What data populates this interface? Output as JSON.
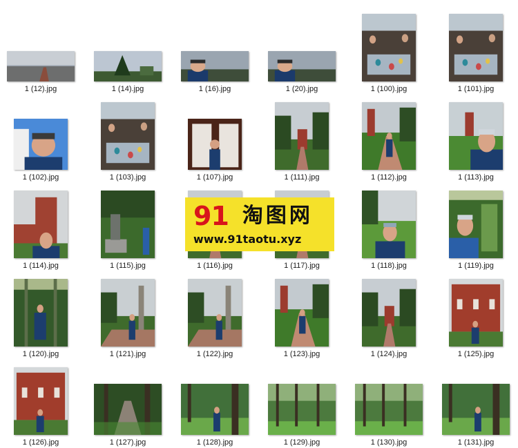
{
  "files": [
    {
      "name": "1 (12).jpg",
      "kind": "landscape",
      "scene": "sky-road"
    },
    {
      "name": "1 (14).jpg",
      "kind": "landscape",
      "scene": "sky-tree"
    },
    {
      "name": "1 (16).jpg",
      "kind": "landscape",
      "scene": "selfie-wide"
    },
    {
      "name": "1 (20).jpg",
      "kind": "landscape",
      "scene": "selfie-wide"
    },
    {
      "name": "1 (100).jpg",
      "kind": "portrait",
      "scene": "crowd"
    },
    {
      "name": "1 (101).jpg",
      "kind": "portrait",
      "scene": "crowd"
    },
    {
      "name": "1 (102).jpg",
      "kind": "portrait-short",
      "scene": "selfie-blue"
    },
    {
      "name": "1 (103).jpg",
      "kind": "portrait",
      "scene": "crowd"
    },
    {
      "name": "1 (107).jpg",
      "kind": "portrait-short",
      "scene": "angels"
    },
    {
      "name": "1 (111).jpg",
      "kind": "portrait",
      "scene": "park-tower"
    },
    {
      "name": "1 (112).jpg",
      "kind": "portrait",
      "scene": "park-person"
    },
    {
      "name": "1 (113).jpg",
      "kind": "portrait",
      "scene": "park-selfie"
    },
    {
      "name": "1 (114).jpg",
      "kind": "portrait",
      "scene": "tower-selfie"
    },
    {
      "name": "1 (115).jpg",
      "kind": "portrait",
      "scene": "statue"
    },
    {
      "name": "1 (116).jpg",
      "kind": "portrait",
      "scene": "park-tower"
    },
    {
      "name": "1 (117).jpg",
      "kind": "portrait",
      "scene": "park-tower"
    },
    {
      "name": "1 (118).jpg",
      "kind": "portrait",
      "scene": "lawn-selfie"
    },
    {
      "name": "1 (119).jpg",
      "kind": "portrait",
      "scene": "arch-selfie"
    },
    {
      "name": "1 (120).jpg",
      "kind": "portrait",
      "scene": "arch-person"
    },
    {
      "name": "1 (121).jpg",
      "kind": "portrait",
      "scene": "column-person"
    },
    {
      "name": "1 (122).jpg",
      "kind": "portrait",
      "scene": "column-person"
    },
    {
      "name": "1 (123).jpg",
      "kind": "portrait",
      "scene": "park-person"
    },
    {
      "name": "1 (124).jpg",
      "kind": "portrait",
      "scene": "park-tower"
    },
    {
      "name": "1 (125).jpg",
      "kind": "portrait",
      "scene": "redbuilding-person"
    },
    {
      "name": "1 (126).jpg",
      "kind": "portrait",
      "scene": "redbuilding-person"
    },
    {
      "name": "1 (127).jpg",
      "kind": "landscape-tall",
      "scene": "forest-path"
    },
    {
      "name": "1 (128).jpg",
      "kind": "landscape-tall",
      "scene": "forest-person"
    },
    {
      "name": "1 (129).jpg",
      "kind": "landscape-tall",
      "scene": "forest"
    },
    {
      "name": "1 (130).jpg",
      "kind": "landscape-tall",
      "scene": "forest"
    },
    {
      "name": "1 (131).jpg",
      "kind": "landscape-tall",
      "scene": "forest-person"
    }
  ],
  "watermark": {
    "number": "91",
    "chinese": "淘图网",
    "url": "www.91taotu.xyz"
  },
  "colors": {
    "watermark_bg": "#f5e12a",
    "watermark_number": "#d8141b"
  }
}
